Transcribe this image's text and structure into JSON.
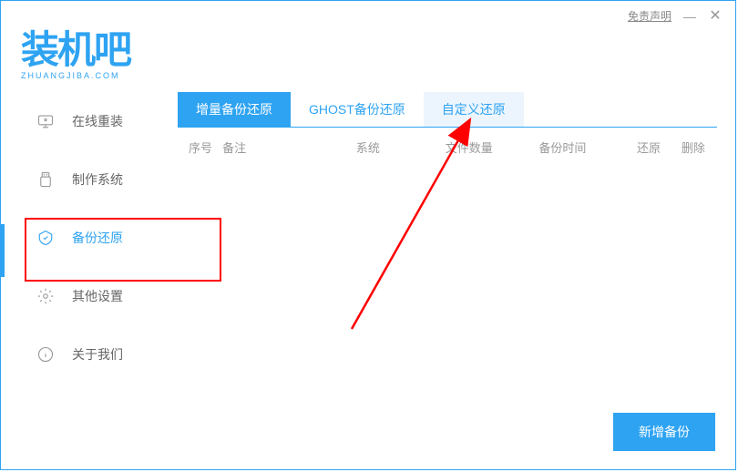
{
  "titlebar": {
    "disclaimer": "免责声明",
    "minimize": "—",
    "close": "✕"
  },
  "logo": {
    "text": "装机吧",
    "domain": "ZHUANGJIBA.COM"
  },
  "sidebar": {
    "items": [
      {
        "label": "在线重装"
      },
      {
        "label": "制作系统"
      },
      {
        "label": "备份还原"
      },
      {
        "label": "其他设置"
      },
      {
        "label": "关于我们"
      }
    ]
  },
  "tabs": {
    "items": [
      {
        "label": "增量备份还原"
      },
      {
        "label": "GHOST备份还原"
      },
      {
        "label": "自定义还原"
      }
    ]
  },
  "table": {
    "headers": {
      "index": "序号",
      "note": "备注",
      "system": "系统",
      "count": "文件数量",
      "time": "备份时间",
      "restore": "还原",
      "delete": "删除"
    }
  },
  "buttons": {
    "new_backup": "新增备份"
  }
}
